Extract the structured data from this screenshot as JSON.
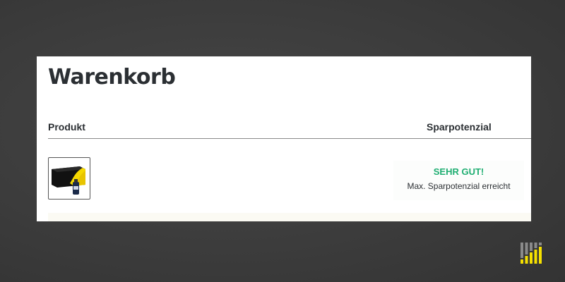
{
  "cart": {
    "title": "Warenkorb",
    "columns": {
      "product": "Produkt",
      "savings": "Sparpotenzial"
    },
    "items": [
      {
        "thumbnail_icon": "toner-cartridge-icon",
        "savings_rating": "SEHR GUT!",
        "savings_note": "Max. Sparpotenzial erreicht"
      }
    ]
  },
  "colors": {
    "background": "#3c3c3c",
    "card": "#ffffff",
    "title_text": "#2b2f33",
    "savings_good": "#1fae72",
    "product_yellow": "#f5d800",
    "logo_gray": "#8a8a8a",
    "logo_yellow": "#f5e000"
  },
  "icons": {
    "brand_logo": "bar-chart-logo-icon"
  }
}
